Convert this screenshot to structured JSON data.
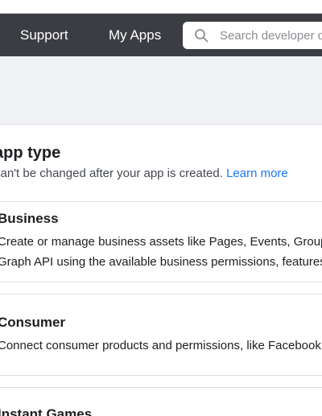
{
  "header": {
    "nav": [
      {
        "label": "Support"
      },
      {
        "label": "My Apps"
      }
    ],
    "search": {
      "placeholder": "Search developer documentation"
    }
  },
  "panel": {
    "title": "app type",
    "subtitle": "can't be changed after your app is created.",
    "learn_more": "Learn more",
    "types": [
      {
        "name": "Business",
        "description_lines": [
          "Create or manage business assets like Pages, Events, Groups, Ads, Messenger and Instagram",
          "Graph API using the available business permissions, features and products."
        ]
      },
      {
        "name": "Consumer",
        "description_lines": [
          "Connect consumer products and permissions, like Facebook Login and Instagram Basic Display to your app."
        ]
      },
      {
        "name": "Instant Games",
        "description_lines": []
      }
    ]
  }
}
